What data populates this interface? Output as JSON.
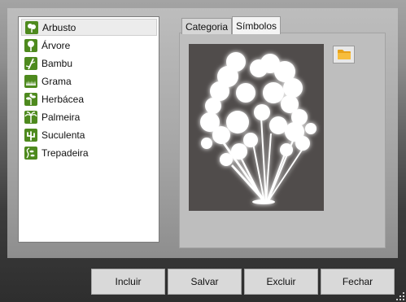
{
  "list": {
    "items": [
      {
        "label": "Arbusto",
        "icon": "shrub-icon",
        "selected": true
      },
      {
        "label": "Árvore",
        "icon": "tree-icon",
        "selected": false
      },
      {
        "label": "Bambu",
        "icon": "bamboo-icon",
        "selected": false
      },
      {
        "label": "Grama",
        "icon": "grass-icon",
        "selected": false
      },
      {
        "label": "Herbácea",
        "icon": "herb-icon",
        "selected": false
      },
      {
        "label": "Palmeira",
        "icon": "palm-icon",
        "selected": false
      },
      {
        "label": "Suculenta",
        "icon": "succulent-icon",
        "selected": false
      },
      {
        "label": "Trepadeira",
        "icon": "vine-icon",
        "selected": false
      }
    ]
  },
  "tabs": {
    "categoria": "Categoria",
    "simbolos": "Símbolos",
    "active": "Símbolos"
  },
  "preview": {
    "icon": "shrub-silhouette",
    "background_color": "#504c4b"
  },
  "folder_button": {
    "icon": "folder-icon",
    "color": "#f5a623"
  },
  "buttons": {
    "incluir": "Incluir",
    "salvar": "Salvar",
    "excluir": "Excluir",
    "fechar": "Fechar"
  },
  "colors": {
    "category_icon_bg": "#4e8a1e",
    "selected_item_bg": "#ececec"
  }
}
